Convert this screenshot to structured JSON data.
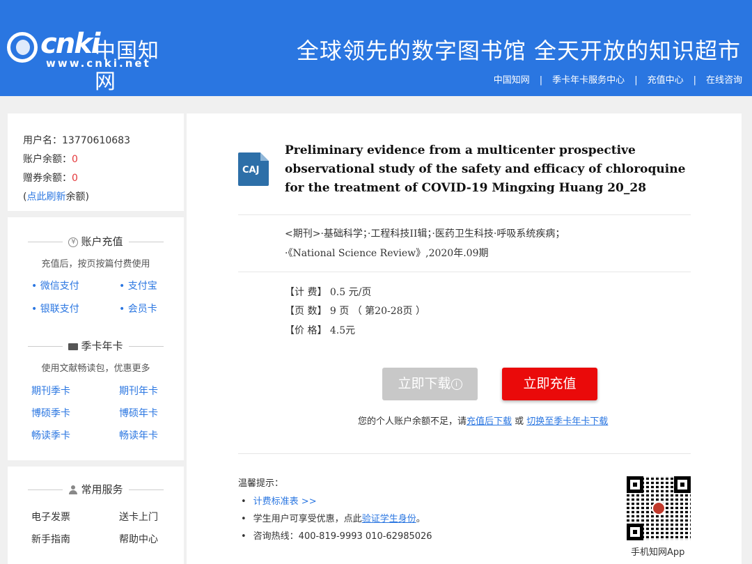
{
  "header": {
    "logo_nki": "cnki",
    "logo_cn": "中国知网",
    "logo_url": "www.cnki.net",
    "slogan": "全球领先的数字图书馆 全天开放的知识超市",
    "nav": [
      "中国知网",
      "季卡年卡服务中心",
      "充值中心",
      "在线咨询"
    ],
    "nav_sep": "|"
  },
  "account": {
    "username_label": "用户名：",
    "username": "13770610683",
    "balance_label": "账户余额：",
    "balance": "0",
    "coupon_label": "赠券余额：",
    "coupon": "0",
    "refresh_open": "(",
    "refresh_link": "点此刷新",
    "refresh_tail": "余额)"
  },
  "recharge": {
    "icon": "¥",
    "title": "账户充值",
    "subtitle": "充值后，按页按篇付费使用",
    "methods": [
      "微信支付",
      "支付宝",
      "银联支付",
      "会员卡"
    ]
  },
  "cards": {
    "title": "季卡年卡",
    "subtitle": "使用文献畅读包，优惠更多",
    "items": [
      "期刊季卡",
      "期刊年卡",
      "博硕季卡",
      "博硕年卡",
      "畅读季卡",
      "畅读年卡"
    ]
  },
  "services": {
    "title": "常用服务",
    "items": [
      "电子发票",
      "送卡上门",
      "新手指南",
      "帮助中心"
    ]
  },
  "article": {
    "badge": "CAJ",
    "title": "Preliminary evidence from a multicenter prospective observational study of the safety and efficacy of chloroquine for the treatment of COVID-19 Mingxing Huang 20_28",
    "meta1": "<期刊>·基础科学；·工程科技II辑；·医药卫生科技·呼吸系统疾病；",
    "meta2": "·《National Science Review》,2020年.09期",
    "fee": "【计 费】 0.5 元/页",
    "pages": "【页 数】 9 页 （ 第20-28页 ）",
    "price": "【价 格】 4.5元"
  },
  "actions": {
    "download": "立即下载",
    "download_info": "i",
    "recharge": "立即充值",
    "tip_text": "您的个人账户余额不足，请",
    "tip_link1": "充值后下载",
    "tip_mid": " 或 ",
    "tip_link2": "切换至季卡年卡下载"
  },
  "notice": {
    "title": "温馨提示：",
    "item1": "计费标准表 >>",
    "item2_text": "学生用户可享受优惠，点此",
    "item2_link": "验证学生身份",
    "item2_tail": "。",
    "item3": "咨询热线：400-819-9993   010-62985026"
  },
  "qr": {
    "label": "手机知网App"
  }
}
